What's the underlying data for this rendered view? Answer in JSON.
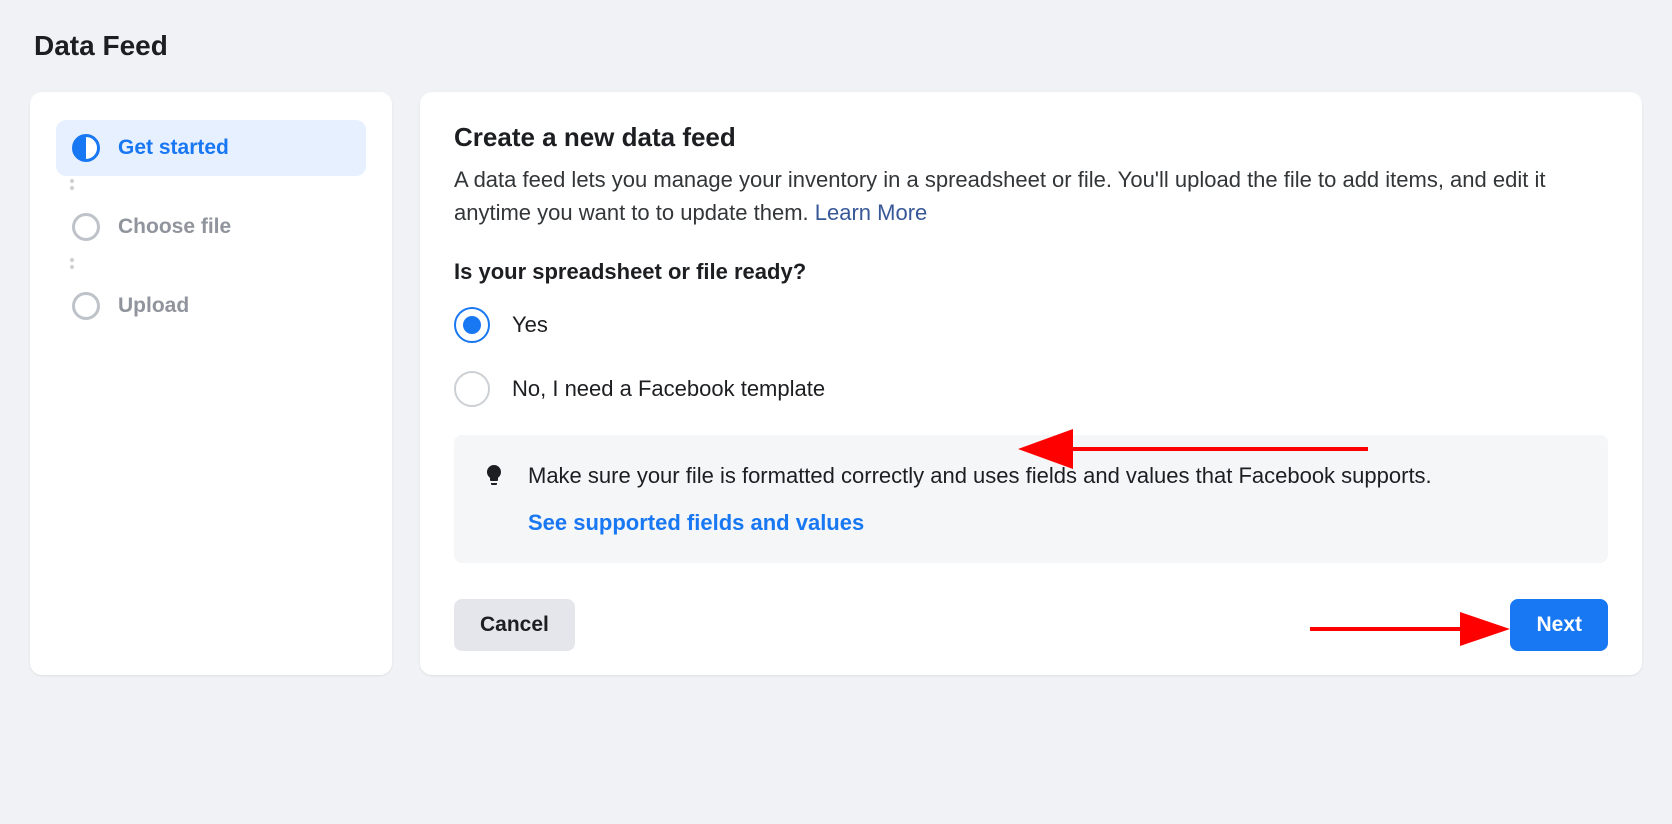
{
  "page": {
    "title": "Data Feed"
  },
  "sidebar": {
    "steps": [
      {
        "label": "Get started",
        "state": "active"
      },
      {
        "label": "Choose file",
        "state": "inactive"
      },
      {
        "label": "Upload",
        "state": "inactive"
      }
    ]
  },
  "main": {
    "title": "Create a new data feed",
    "description_part1": "A data feed lets you manage your inventory in a spreadsheet or file. You'll upload the file to add items, and edit it anytime you want to to update them. ",
    "description_link": "Learn More",
    "question": "Is your spreadsheet or file ready?",
    "options": [
      {
        "label": "Yes",
        "selected": true
      },
      {
        "label": "No, I need a Facebook template",
        "selected": false
      }
    ],
    "info": {
      "text": "Make sure your file is formatted correctly and uses fields and values that Facebook supports.",
      "link": "See supported fields and values"
    },
    "buttons": {
      "cancel": "Cancel",
      "next": "Next"
    }
  }
}
